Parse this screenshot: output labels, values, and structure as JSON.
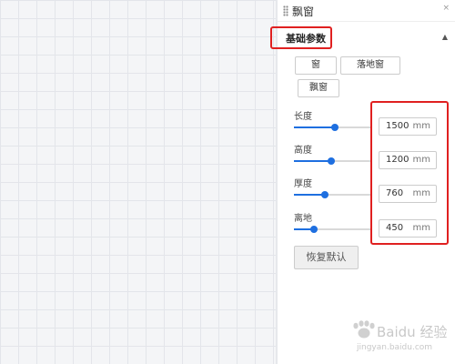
{
  "panel": {
    "title": "飘窗",
    "collapse_icon": "×",
    "section_title": "基础参数",
    "caret": "▲"
  },
  "window_types": [
    {
      "label": "窗"
    },
    {
      "label": "落地窗"
    },
    {
      "label": "飘窗"
    }
  ],
  "params": [
    {
      "label": "长度",
      "value": "1500",
      "unit": "mm",
      "slider_fraction": 0.52
    },
    {
      "label": "高度",
      "value": "1200",
      "unit": "mm",
      "slider_fraction": 0.48
    },
    {
      "label": "厚度",
      "value": "760",
      "unit": "mm",
      "slider_fraction": 0.4
    },
    {
      "label": "离地",
      "value": "450",
      "unit": "mm",
      "slider_fraction": 0.26
    }
  ],
  "reset_label": "恢复默认",
  "watermark": {
    "text": "Baidu 经验",
    "sub": "jingyan.baidu.com"
  },
  "colors": {
    "accent": "#1e6fe0",
    "highlight": "#e02020"
  }
}
